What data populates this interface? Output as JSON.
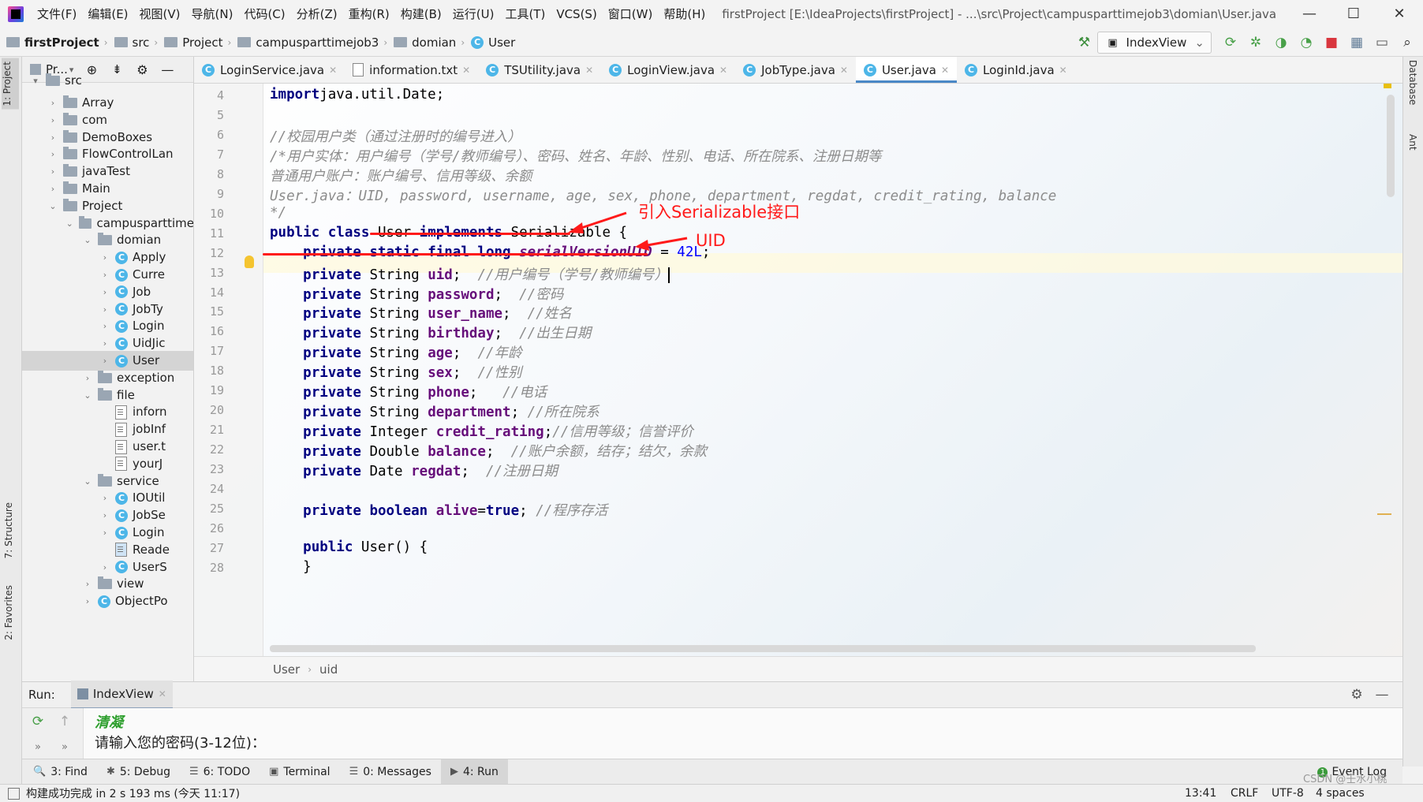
{
  "menubar": {
    "items": [
      "文件(F)",
      "编辑(E)",
      "视图(V)",
      "导航(N)",
      "代码(C)",
      "分析(Z)",
      "重构(R)",
      "构建(B)",
      "运行(U)",
      "工具(T)",
      "VCS(S)",
      "窗口(W)",
      "帮助(H)"
    ],
    "title": "firstProject [E:\\IdeaProjects\\firstProject] - ...\\src\\Project\\campusparttimejob3\\domian\\User.java",
    "minimize": "—",
    "maximize": "☐",
    "close": "✕"
  },
  "navbar": {
    "crumbs": [
      "firstProject",
      "src",
      "Project",
      "campusparttimejob3",
      "domian",
      "User"
    ],
    "run_config": "IndexView"
  },
  "project_panel": {
    "header": "Pr...",
    "tree": [
      {
        "label": "src",
        "kind": "folder",
        "depth": 0,
        "arrow": "▾",
        "partial": true
      },
      {
        "label": "Array",
        "kind": "folder",
        "depth": 1,
        "arrow": "›"
      },
      {
        "label": "com",
        "kind": "folder",
        "depth": 1,
        "arrow": "›"
      },
      {
        "label": "DemoBoxes",
        "kind": "folder",
        "depth": 1,
        "arrow": "›"
      },
      {
        "label": "FlowControlLan",
        "kind": "folder",
        "depth": 1,
        "arrow": "›"
      },
      {
        "label": "javaTest",
        "kind": "folder",
        "depth": 1,
        "arrow": "›"
      },
      {
        "label": "Main",
        "kind": "folder",
        "depth": 1,
        "arrow": "›"
      },
      {
        "label": "Project",
        "kind": "folder",
        "depth": 1,
        "arrow": "⌄"
      },
      {
        "label": "campusparttime",
        "kind": "folder",
        "depth": 2,
        "arrow": "⌄"
      },
      {
        "label": "domian",
        "kind": "folder",
        "depth": 3,
        "arrow": "⌄"
      },
      {
        "label": "Apply",
        "kind": "class",
        "depth": 4,
        "arrow": "›"
      },
      {
        "label": "Curre",
        "kind": "class",
        "depth": 4,
        "arrow": "›"
      },
      {
        "label": "Job",
        "kind": "class",
        "depth": 4,
        "arrow": "›"
      },
      {
        "label": "JobTy",
        "kind": "class",
        "depth": 4,
        "arrow": "›"
      },
      {
        "label": "Login",
        "kind": "class",
        "depth": 4,
        "arrow": "›"
      },
      {
        "label": "UidJic",
        "kind": "class",
        "depth": 4,
        "arrow": "›"
      },
      {
        "label": "User",
        "kind": "class",
        "depth": 4,
        "arrow": "›",
        "selected": true
      },
      {
        "label": "exception",
        "kind": "folder",
        "depth": 3,
        "arrow": "›"
      },
      {
        "label": "file",
        "kind": "folder",
        "depth": 3,
        "arrow": "⌄"
      },
      {
        "label": "inforn",
        "kind": "file",
        "depth": 4,
        "arrow": ""
      },
      {
        "label": "jobInf",
        "kind": "file",
        "depth": 4,
        "arrow": ""
      },
      {
        "label": "user.t",
        "kind": "file",
        "depth": 4,
        "arrow": ""
      },
      {
        "label": "yourJ",
        "kind": "file",
        "depth": 4,
        "arrow": ""
      },
      {
        "label": "service",
        "kind": "folder",
        "depth": 3,
        "arrow": "⌄"
      },
      {
        "label": "IOUtil",
        "kind": "class",
        "depth": 4,
        "arrow": "›"
      },
      {
        "label": "JobSe",
        "kind": "class",
        "depth": 4,
        "arrow": "›"
      },
      {
        "label": "Login",
        "kind": "class",
        "depth": 4,
        "arrow": "›"
      },
      {
        "label": "Reade",
        "kind": "image",
        "depth": 4,
        "arrow": ""
      },
      {
        "label": "UserS",
        "kind": "class",
        "depth": 4,
        "arrow": "›"
      },
      {
        "label": "view",
        "kind": "folder",
        "depth": 3,
        "arrow": "›"
      },
      {
        "label": "ObjectPo",
        "kind": "class",
        "depth": 3,
        "arrow": "›"
      }
    ]
  },
  "editor_tabs": [
    {
      "label": "LoginService.java",
      "kind": "class",
      "active": false
    },
    {
      "label": "information.txt",
      "kind": "text",
      "active": false
    },
    {
      "label": "TSUtility.java",
      "kind": "class",
      "active": false
    },
    {
      "label": "LoginView.java",
      "kind": "class",
      "active": false
    },
    {
      "label": "JobType.java",
      "kind": "class",
      "active": false
    },
    {
      "label": "User.java",
      "kind": "class",
      "active": true
    },
    {
      "label": "LoginId.java",
      "kind": "class",
      "active": false
    }
  ],
  "editor": {
    "line_numbers": [
      "4",
      "5",
      "6",
      "7",
      "8",
      "9",
      "10",
      "11",
      "12",
      "13",
      "14",
      "15",
      "16",
      "17",
      "18",
      "19",
      "20",
      "21",
      "22",
      "23",
      "24",
      "25",
      "26",
      "27",
      "28"
    ],
    "lines": [
      {
        "tokens": [
          [
            "kw",
            "import"
          ],
          [
            "",
            "java.util.Date;"
          ]
        ]
      },
      {
        "tokens": []
      },
      {
        "tokens": [
          [
            "cmt",
            "//校园用户类（通过注册时的编号进入）"
          ]
        ]
      },
      {
        "tokens": [
          [
            "cmt",
            "/*用户实体：用户编号（学号/教师编号）、密码、姓名、年龄、性别、电话、所在院系、注册日期等"
          ]
        ]
      },
      {
        "tokens": [
          [
            "cmt",
            "普通用户账户：账户编号、信用等级、余额"
          ]
        ]
      },
      {
        "tokens": [
          [
            "cmt",
            "User.java：UID, password, username, age, sex, phone, department, regdat, credit_rating, balance"
          ]
        ]
      },
      {
        "tokens": [
          [
            "cmt",
            "*/"
          ]
        ]
      },
      {
        "tokens": [
          [
            "kw",
            "public class "
          ],
          [
            "",
            "User "
          ],
          [
            "kw",
            "implements "
          ],
          [
            "",
            "Serializable {"
          ]
        ]
      },
      {
        "tokens": [
          [
            "",
            "    "
          ],
          [
            "kw",
            "private static final long "
          ],
          [
            "cn",
            "serialVersionUID"
          ],
          [
            "",
            " = "
          ],
          [
            "num",
            "42L"
          ],
          [
            "",
            ";"
          ]
        ]
      },
      {
        "tokens": [
          [
            "",
            "    "
          ],
          [
            "kw",
            "private "
          ],
          [
            "",
            "String "
          ],
          [
            "fld",
            "uid"
          ],
          [
            "",
            ";  "
          ],
          [
            "cmt",
            "//用户编号（学号/教师编号）"
          ]
        ]
      },
      {
        "tokens": [
          [
            "",
            "    "
          ],
          [
            "kw",
            "private "
          ],
          [
            "",
            "String "
          ],
          [
            "fld",
            "password"
          ],
          [
            "",
            ";  "
          ],
          [
            "cmt",
            "//密码"
          ]
        ]
      },
      {
        "tokens": [
          [
            "",
            "    "
          ],
          [
            "kw",
            "private "
          ],
          [
            "",
            "String "
          ],
          [
            "fld",
            "user_name"
          ],
          [
            "",
            ";  "
          ],
          [
            "cmt",
            "//姓名"
          ]
        ]
      },
      {
        "tokens": [
          [
            "",
            "    "
          ],
          [
            "kw",
            "private "
          ],
          [
            "",
            "String "
          ],
          [
            "fld",
            "birthday"
          ],
          [
            "",
            ";  "
          ],
          [
            "cmt",
            "//出生日期"
          ]
        ]
      },
      {
        "tokens": [
          [
            "",
            "    "
          ],
          [
            "kw",
            "private "
          ],
          [
            "",
            "String "
          ],
          [
            "fld",
            "age"
          ],
          [
            "",
            ";  "
          ],
          [
            "cmt",
            "//年龄"
          ]
        ]
      },
      {
        "tokens": [
          [
            "",
            "    "
          ],
          [
            "kw",
            "private "
          ],
          [
            "",
            "String "
          ],
          [
            "fld",
            "sex"
          ],
          [
            "",
            ";  "
          ],
          [
            "cmt",
            "//性别"
          ]
        ]
      },
      {
        "tokens": [
          [
            "",
            "    "
          ],
          [
            "kw",
            "private "
          ],
          [
            "",
            "String "
          ],
          [
            "fld",
            "phone"
          ],
          [
            "",
            ";   "
          ],
          [
            "cmt",
            "//电话"
          ]
        ]
      },
      {
        "tokens": [
          [
            "",
            "    "
          ],
          [
            "kw",
            "private "
          ],
          [
            "",
            "String "
          ],
          [
            "fld",
            "department"
          ],
          [
            "",
            "; "
          ],
          [
            "cmt",
            "//所在院系"
          ]
        ]
      },
      {
        "tokens": [
          [
            "",
            "    "
          ],
          [
            "kw",
            "private "
          ],
          [
            "",
            "Integer "
          ],
          [
            "fld",
            "credit_rating"
          ],
          [
            "",
            ";"
          ],
          [
            "cmt",
            "//信用等级；信誉评价"
          ]
        ]
      },
      {
        "tokens": [
          [
            "",
            "    "
          ],
          [
            "kw",
            "private "
          ],
          [
            "",
            "Double "
          ],
          [
            "fld",
            "balance"
          ],
          [
            "",
            ";  "
          ],
          [
            "cmt",
            "//账户余额，结存；结欠，余款"
          ]
        ]
      },
      {
        "tokens": [
          [
            "",
            "    "
          ],
          [
            "kw",
            "private "
          ],
          [
            "",
            "Date "
          ],
          [
            "fld",
            "regdat"
          ],
          [
            "",
            ";  "
          ],
          [
            "cmt",
            "//注册日期"
          ]
        ]
      },
      {
        "tokens": []
      },
      {
        "tokens": [
          [
            "",
            "    "
          ],
          [
            "kw",
            "private boolean "
          ],
          [
            "fld",
            "alive"
          ],
          [
            "",
            "="
          ],
          [
            "kw",
            "true"
          ],
          [
            "",
            "; "
          ],
          [
            "cmt",
            "//程序存活"
          ]
        ]
      },
      {
        "tokens": []
      },
      {
        "tokens": [
          [
            "",
            "    "
          ],
          [
            "kw",
            "public "
          ],
          [
            "",
            "User() {"
          ]
        ]
      },
      {
        "tokens": [
          [
            "",
            "    }"
          ]
        ]
      }
    ],
    "annotation_serializable": "引入Serializable接口",
    "annotation_uid": "UID",
    "breadcrumb": [
      "User",
      "uid"
    ]
  },
  "run_panel": {
    "label": "Run:",
    "tab": "IndexView",
    "console": [
      "清凝",
      "请输入您的密码(3-12位)："
    ]
  },
  "tool_tabs": [
    {
      "label": "3: Find",
      "icon": "🔍"
    },
    {
      "label": "5: Debug",
      "icon": "✱"
    },
    {
      "label": "6: TODO",
      "icon": "☰"
    },
    {
      "label": "Terminal",
      "icon": "▣"
    },
    {
      "label": "0: Messages",
      "icon": "☰"
    },
    {
      "label": "4: Run",
      "icon": "▶",
      "active": true
    }
  ],
  "event_log": "Event Log",
  "left_strip": {
    "project": "1: Project",
    "structure": "7: Structure",
    "favorites": "2: Favorites"
  },
  "right_strip": {
    "database": "Database",
    "ant": "Ant"
  },
  "statusbar": {
    "message": "构建成功完成 in 2 s 193 ms (今天 11:17)",
    "position": "13:41",
    "line_sep": "CRLF",
    "encoding": "UTF-8",
    "indent": "4 spaces"
  },
  "watermark": "CSDN @壬水小桃"
}
